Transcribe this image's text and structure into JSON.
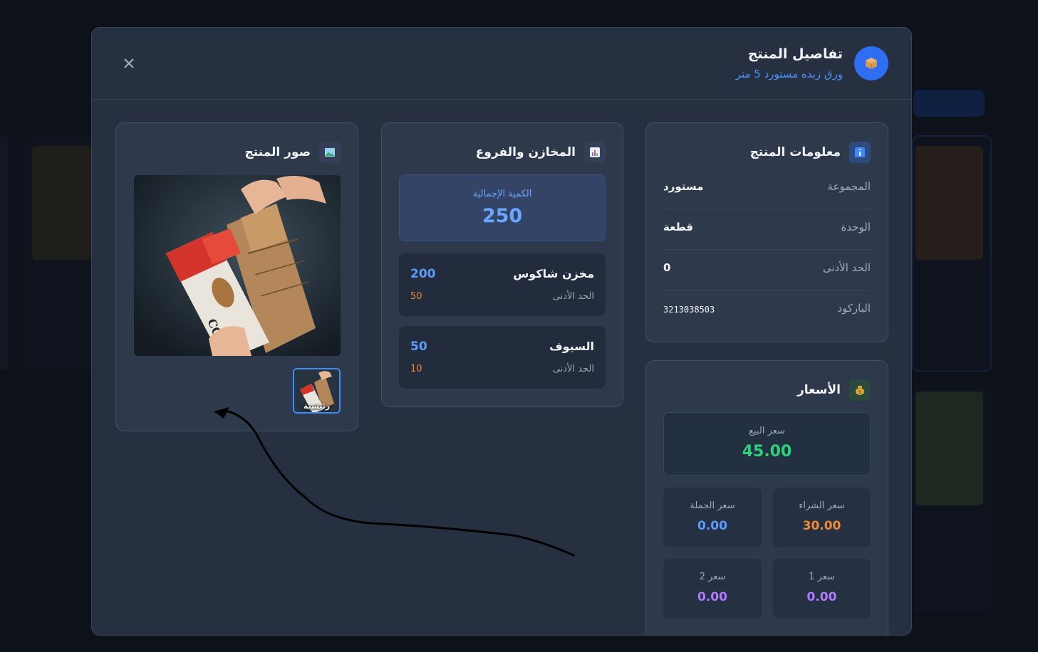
{
  "modal": {
    "title": "تفاصيل المنتج",
    "subtitle": "ورق زبده مستورد 5 متر",
    "header_icon": "package-icon",
    "close_icon": "close-icon"
  },
  "product_info": {
    "title": "معلومات المنتج",
    "icon": "info-icon",
    "rows": [
      {
        "label": "المجموعة",
        "value": "مستورد"
      },
      {
        "label": "الوحدة",
        "value": "قطعة"
      },
      {
        "label": "الحد الأدنى",
        "value": "0"
      },
      {
        "label": "الباركود",
        "value": "3213038503"
      }
    ]
  },
  "prices": {
    "title": "الأسعار",
    "icon": "money-bag-icon",
    "sale_label": "سعر البيع",
    "sale_value": "45.00",
    "purchase_label": "سعر الشراء",
    "purchase_value": "30.00",
    "wholesale_label": "سعر الجملة",
    "wholesale_value": "0.00",
    "price1_label": "سعر 1",
    "price1_value": "0.00",
    "price2_label": "سعر 2",
    "price2_value": "0.00",
    "colors": {
      "sale": "#2fd07a",
      "purchase": "#f18a35",
      "wholesale": "#5b9cff",
      "alt": "#b07bff"
    }
  },
  "stores": {
    "title": "المخازن والفروع",
    "icon": "bar-chart-icon",
    "total_label": "الكمية الإجمالية",
    "total_value": "250",
    "items": [
      {
        "name": "مخزن شاكوس",
        "qty": "200",
        "min_label": "الحد الأدنى",
        "min_value": "50"
      },
      {
        "name": "السيوف",
        "qty": "50",
        "min_label": "الحد الأدنى",
        "min_value": "10"
      }
    ]
  },
  "images": {
    "title": "صور المنتج",
    "icon": "image-icon",
    "thumb_label": "رئيسية",
    "product_image_text": "COOKING"
  }
}
